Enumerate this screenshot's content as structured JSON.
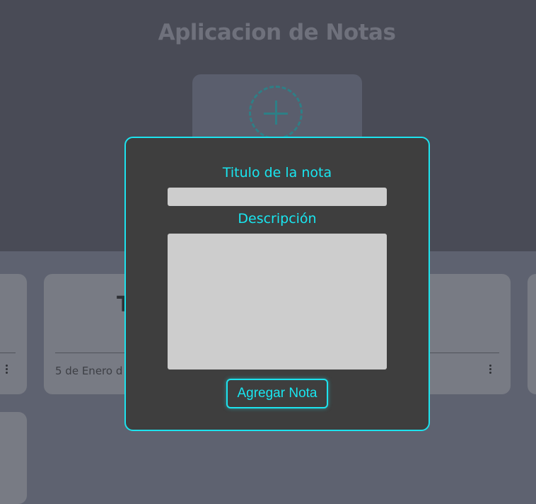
{
  "app": {
    "title": "Aplicacion de Notas"
  },
  "notes": [
    {
      "title": "T",
      "date": "5 de Enero d"
    }
  ],
  "modal": {
    "title_label": "Titulo de la nota",
    "description_label": "Descripción",
    "submit_label": "Agregar Nota",
    "title_value": "",
    "description_value": ""
  },
  "colors": {
    "accent": "#1de3ee",
    "modal_bg": "#3e3e3e",
    "page_bg": "#5e6270"
  }
}
